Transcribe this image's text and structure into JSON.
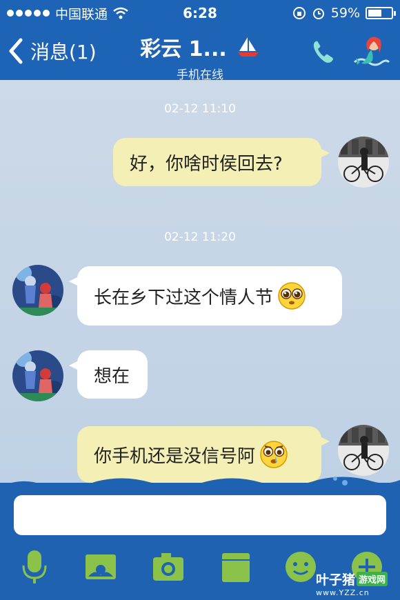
{
  "status_bar": {
    "carrier": "中国联通",
    "time": "6:28",
    "battery": "59%",
    "battery_level": 0.59,
    "icons": [
      "signal-dots",
      "wifi-icon",
      "rotation-lock-icon",
      "alarm-icon",
      "battery-icon"
    ]
  },
  "nav": {
    "back_label": "消息(1)",
    "title": "彩云 1...",
    "subtitle": "手机在线",
    "icons": [
      "back-chevron-icon",
      "sailboat-icon",
      "phone-icon",
      "mermaid-avatar"
    ]
  },
  "messages": [
    {
      "type": "timestamp",
      "text": "02-12 11:10"
    },
    {
      "type": "outgoing",
      "text": "好，你啥时侯回去?"
    },
    {
      "type": "timestamp",
      "text": "02-12 11:20"
    },
    {
      "type": "incoming",
      "text": "长在乡下过这个情人节",
      "emoji": "pleading-face-emoji"
    },
    {
      "type": "incoming",
      "text": "想在"
    },
    {
      "type": "outgoing",
      "text": "你手机还是没信号阿",
      "emoji": "crying-face-emoji"
    }
  ],
  "input": {
    "value": "",
    "placeholder": ""
  },
  "toolbar": {
    "icons": [
      "microphone-icon",
      "image-gallery-icon",
      "camera-icon",
      "folder-icon",
      "smiley-icon",
      "plus-icon"
    ]
  },
  "watermark": {
    "line1_a": "叶子猪",
    "line1_b": "游戏网",
    "line2": "www.YZZ.cn"
  },
  "colors": {
    "brand_blue": "#1e64b6",
    "chat_bg": "#c9d9ea",
    "outgoing_bubble": "#f4efb4",
    "incoming_bubble": "#ffffff",
    "toolbar_icon_green": "#8bc34a"
  }
}
